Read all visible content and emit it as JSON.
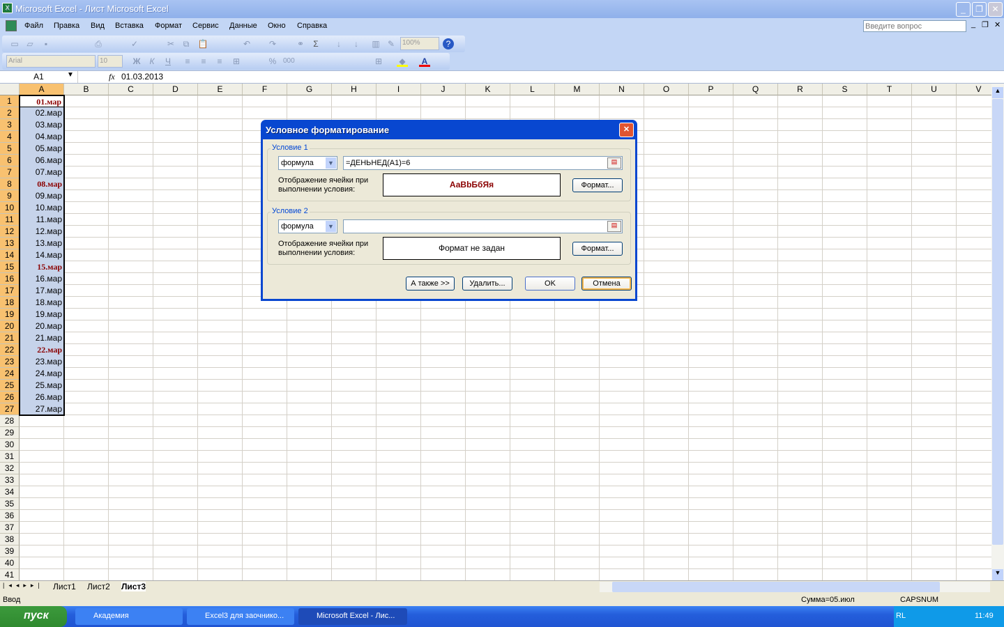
{
  "window": {
    "title": "Microsoft Excel - Лист Microsoft Excel",
    "min": "_",
    "restore": "❐",
    "close": "✕"
  },
  "menu": {
    "items": [
      "Файл",
      "Правка",
      "Вид",
      "Вставка",
      "Формат",
      "Сервис",
      "Данные",
      "Окно",
      "Справка"
    ],
    "help_placeholder": "Введите вопрос",
    "doc_min": "_",
    "doc_restore": "❐",
    "doc_close": "✕"
  },
  "toolbar": {
    "zoom": "100%",
    "font": "Arial",
    "size": "10",
    "bold": "Ж",
    "italic": "К",
    "underline": "Ч",
    "percent": "%",
    "thousands": "000",
    "sigma": "Σ"
  },
  "formula": {
    "namebox": "A1",
    "fx": "fx",
    "value": "01.03.2013"
  },
  "columns": [
    "A",
    "B",
    "C",
    "D",
    "E",
    "F",
    "G",
    "H",
    "I",
    "J",
    "K",
    "L",
    "M",
    "N",
    "O",
    "P",
    "Q",
    "R",
    "S",
    "T",
    "U",
    "V"
  ],
  "row_count": 41,
  "cells_a": [
    "01.мар",
    "02.мар",
    "03.мар",
    "04.мар",
    "05.мар",
    "06.мар",
    "07.мар",
    "08.мар",
    "09.мар",
    "10.мар",
    "11.мар",
    "12.мар",
    "13.мар",
    "14.мар",
    "15.мар",
    "16.мар",
    "17.мар",
    "18.мар",
    "19.мар",
    "20.мар",
    "21.мар",
    "22.мар",
    "23.мар",
    "24.мар",
    "25.мар",
    "26.мар",
    "27.мар"
  ],
  "highlighted_rows": [
    1,
    8,
    15,
    22
  ],
  "colors": {
    "highlight": "#8b0000",
    "selection": "#c6d3ea"
  },
  "sheets": {
    "tabs": [
      "Лист1",
      "Лист2",
      "Лист3"
    ],
    "active": "Лист3"
  },
  "status": {
    "mode": "Ввод",
    "sum": "Сумма=05.июл",
    "caps": "CAPS",
    "num": "NUM"
  },
  "taskbar": {
    "start": "пуск",
    "items": [
      "Академия",
      "Excel3 для заочнико...",
      "Microsoft Excel - Лис..."
    ],
    "lang": "RL",
    "clock": "11:49"
  },
  "dialog": {
    "title": "Условное форматирование",
    "cond1": {
      "label": "Условие 1",
      "type": "формула",
      "formula": "=ДЕНЬНЕД(A1)=6",
      "preview_label": "Отображение ячейки при выполнении условия:",
      "preview": "АаBbБбЯя",
      "format_btn": "Формат..."
    },
    "cond2": {
      "label": "Условие 2",
      "type": "формула",
      "formula": "",
      "preview_label": "Отображение ячейки при выполнении условия:",
      "preview": "Формат не задан",
      "format_btn": "Формат..."
    },
    "also": "А также >>",
    "delete": "Удалить...",
    "ok": "OK",
    "cancel": "Отмена"
  }
}
